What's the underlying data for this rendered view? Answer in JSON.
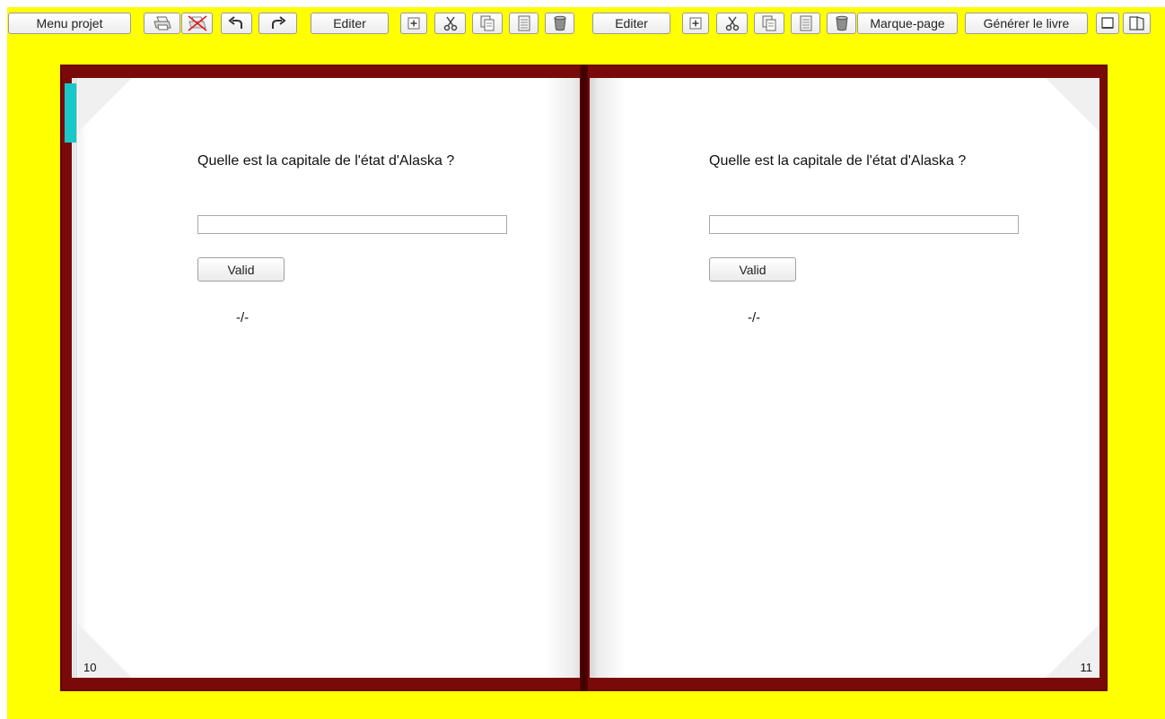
{
  "toolbar": {
    "menu_projet": "Menu projet",
    "editer_left": "Editer",
    "editer_right": "Editer",
    "marque_page": "Marque-page",
    "generer_livre": "Générer le livre",
    "icons": [
      "print-icon",
      "no-print-icon",
      "undo-icon",
      "redo-icon",
      "add-icon",
      "cut-icon",
      "copy-icon",
      "paste-icon",
      "trash-icon",
      "single-page-view-icon",
      "double-page-view-icon"
    ]
  },
  "book": {
    "cover_color": "#7a0a0a",
    "bookmark_color": "#19c8c8",
    "left_page": {
      "question": "Quelle est la capitale de l'état d'Alaska ?",
      "answer_value": "",
      "button_label": "Valid",
      "result": "-/-",
      "page_number": "10"
    },
    "right_page": {
      "question": "Quelle est la capitale de l'état d'Alaska ?",
      "answer_value": "",
      "button_label": "Valid",
      "result": "-/-",
      "page_number": "11"
    }
  },
  "colors": {
    "background": "#ffff00",
    "cover": "#7a0a0a"
  }
}
